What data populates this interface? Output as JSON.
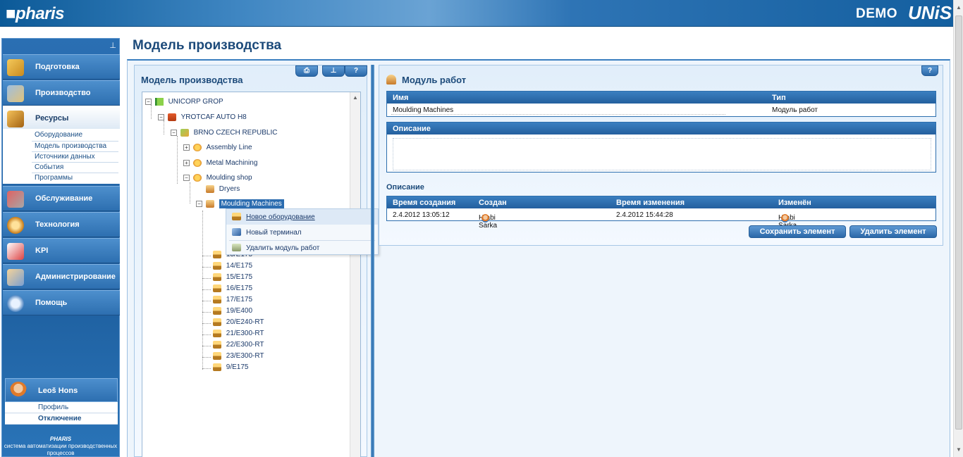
{
  "header": {
    "logo": "■pharis",
    "demo": "DEMO",
    "brand": "UNiS"
  },
  "sidebar": {
    "pin_icon": "pin-icon",
    "items": [
      {
        "label": "Подготовка",
        "icon": "book-icon"
      },
      {
        "label": "Производство",
        "icon": "production-icon"
      },
      {
        "label": "Ресурсы",
        "icon": "resources-icon",
        "active": true
      },
      {
        "label": "Обслуживание",
        "icon": "maintenance-icon"
      },
      {
        "label": "Технология",
        "icon": "technology-icon"
      },
      {
        "label": "KPI",
        "icon": "kpi-chart-icon"
      },
      {
        "label": "Администрирование",
        "icon": "administration-icon"
      },
      {
        "label": "Помощь",
        "icon": "help-icon"
      }
    ],
    "subitems": [
      "Оборудование",
      "Модель производства",
      "Источники данных",
      "События",
      "Программы"
    ],
    "user": {
      "name": "Leoš Hons",
      "profile": "Профиль",
      "logout": "Отключение"
    },
    "footer": {
      "brand": "PHARIS",
      "tagline": "система автоматизации производственных процессов"
    }
  },
  "main": {
    "page_title": "Модель производства",
    "left_panel": {
      "title": "Модель производства",
      "toolbar": {
        "print": "⎙",
        "pin": "⊥",
        "help": "?"
      },
      "tree": {
        "root": "UNICORP GROP",
        "company": "YROTCAF AUTO H8",
        "site": "BRNO CZECH REPUBLIC",
        "lines": [
          "Assembly Line",
          "Metal Machining",
          "Moulding shop"
        ],
        "work_units": [
          "Dryers",
          "Moulding Machines"
        ],
        "machines": [
          "13/E175",
          "14/E175",
          "15/E175",
          "16/E175",
          "17/E175",
          "19/E400",
          "20/E240-RT",
          "21/E300-RT",
          "22/E300-RT",
          "23/E300-RT",
          "9/E175"
        ]
      },
      "context_menu": {
        "items": [
          "Новое оборудование",
          "Новый терминал",
          "Удалить модуль работ"
        ]
      }
    },
    "right_panel": {
      "title": "Модуль работ",
      "help": "?",
      "grid1": {
        "headers": [
          "Имя",
          "Тип"
        ],
        "row": [
          "Moulding Machines",
          "Модуль работ"
        ]
      },
      "description_label": "Описание",
      "description_value": "",
      "audit_label": "Описание",
      "grid2": {
        "headers": [
          "Время создания",
          "Создан",
          "Время изменения",
          "Изменён"
        ],
        "row": [
          "2.4.2012 13:05:12",
          "Hrabi Sarka",
          "2.4.2012 15:44:28",
          "Hrabi Sarka"
        ]
      },
      "buttons": {
        "save": "Сохранить элемент",
        "delete": "Удалить элемент"
      }
    }
  }
}
